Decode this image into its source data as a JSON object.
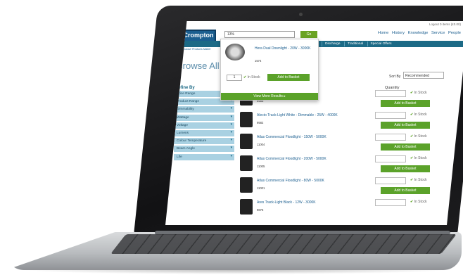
{
  "topbar": "Logout   0 items (£0.00)",
  "logo": {
    "name": "Crompton",
    "sub": "LAMPS",
    "tagline": "Because Products Matter"
  },
  "search": {
    "value": "13%",
    "button": "Go"
  },
  "topnav": [
    "Home",
    "History",
    "Knowledge",
    "Service",
    "People"
  ],
  "navlinks": [
    "Discharge",
    "Traditional",
    "Special Offers"
  ],
  "heading": "Browse All P",
  "sort": {
    "label": "Sort By",
    "value": "Recommended"
  },
  "quantity_label": "Quantity",
  "refine_label": "Refine By",
  "filters": [
    "Price Range",
    "Product Range",
    "Dimmability",
    "Wattage",
    "Voltage",
    "Lumens",
    "Colour Temperature",
    "Beam Angle",
    "Life"
  ],
  "products": [
    {
      "name": "- 25W -",
      "code": "9585"
    },
    {
      "name": "Alecto Track-Light White - Dimmable - 25W - 4000K",
      "code": "9582"
    },
    {
      "name": "Atlas Commercial Floodlight - 150W - 5000K",
      "code": "11004"
    },
    {
      "name": "Atlas Commercial Floodlight - 200W - 5000K",
      "code": "11005"
    },
    {
      "name": "Atlas Commercial Floodlight - 80W - 5000K",
      "code": "11001"
    },
    {
      "name": "Ares Track-Light Black - 12W - 3000K",
      "code": "9876"
    }
  ],
  "stock_label": "In Stock",
  "add_label": "Add to Basket",
  "dropdown": {
    "name": "Hera Dual Downlight - 20W - 3000K",
    "code": "1574",
    "qty": "1",
    "stock": "In Stock",
    "add": "Add to Basket",
    "more": "View More Results ▸"
  }
}
